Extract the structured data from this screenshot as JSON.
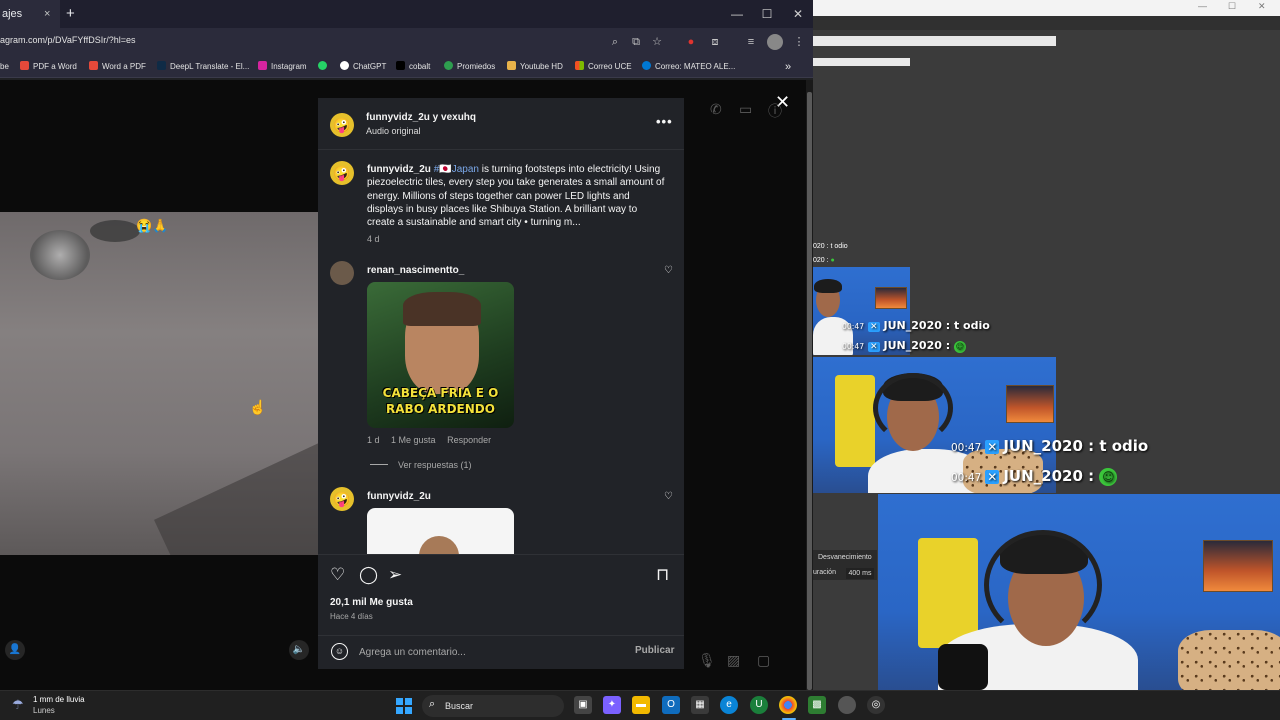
{
  "browser": {
    "tab_title": "ajes",
    "tab_close": "×",
    "new_tab": "+",
    "window_controls": {
      "minimize": "—",
      "maximize": "☐",
      "close": "✕"
    },
    "url": "agram.com/p/DVaFYffDSIr/?hl=es",
    "bookmarks": [
      {
        "label": "be",
        "color": "#ff3b30"
      },
      {
        "label": "PDF a Word",
        "color": "#e5493a"
      },
      {
        "label": "Word a PDF",
        "color": "#e5493a"
      },
      {
        "label": "DeepL Translate - El...",
        "color": "#0f2b46"
      },
      {
        "label": "Instagram",
        "color": "#d6249f"
      },
      {
        "label": "",
        "color": "#25d366"
      },
      {
        "label": "ChatGPT",
        "color": "#ffffff"
      },
      {
        "label": "cobalt",
        "color": "#000000"
      },
      {
        "label": "Promiedos",
        "color": "#2e9e4f"
      },
      {
        "label": "Youtube HD",
        "color": "#e8b24a"
      },
      {
        "label": "Correo UCE",
        "color": "#f25022"
      },
      {
        "label": "Correo: MATEO ALE...",
        "color": "#0078d4"
      }
    ],
    "bookmarks_overflow": "»"
  },
  "post": {
    "header_user": "funnyvidz_2u y vexuhq",
    "header_sub": "Audio original",
    "more": "•••",
    "caption": {
      "user": "funnyvidz_2u",
      "hashtag": "#🇯🇵Japan",
      "text": " is turning footsteps into electricity! Using piezoelectric tiles, every step you take generates a small amount of energy. Millions of steps together can power LED lights and displays in busy places like Shibuya Station. A brilliant way to create a sustainable and smart city • turning m...",
      "time": "4 d"
    },
    "comments": [
      {
        "user": "renan_nascimentto_",
        "gif_text": "CABEÇA FRIA E O RABO ARDENDO",
        "time": "1 d",
        "likes": "1 Me gusta",
        "reply": "Responder",
        "view_replies": "Ver respuestas (1)"
      },
      {
        "user": "funnyvidz_2u"
      }
    ],
    "likes": "20,1 mil Me gusta",
    "ago": "Hace 4 días",
    "comment_placeholder": "Agrega un comentario...",
    "publish": "Publicar",
    "video_emoji": "😭🙏"
  },
  "overlay": {
    "small_line1": "020 : t odio",
    "small_line2": "020 :",
    "time": "00:47",
    "user": "JUN_2020",
    "msg1": " : t odio",
    "msg2": " :"
  },
  "obs": {
    "desvanecimiento": "Desvanecimiento",
    "duracion": "uración",
    "duracion_val": "400 ms"
  },
  "taskbar": {
    "weather_line1": "1 mm de lluvia",
    "weather_line2": "Lunes",
    "search": "Buscar"
  },
  "colors": {
    "ig_panel": "#212328",
    "hashtag": "#7aa7e8",
    "tab_bar": "#1f1f2e"
  }
}
